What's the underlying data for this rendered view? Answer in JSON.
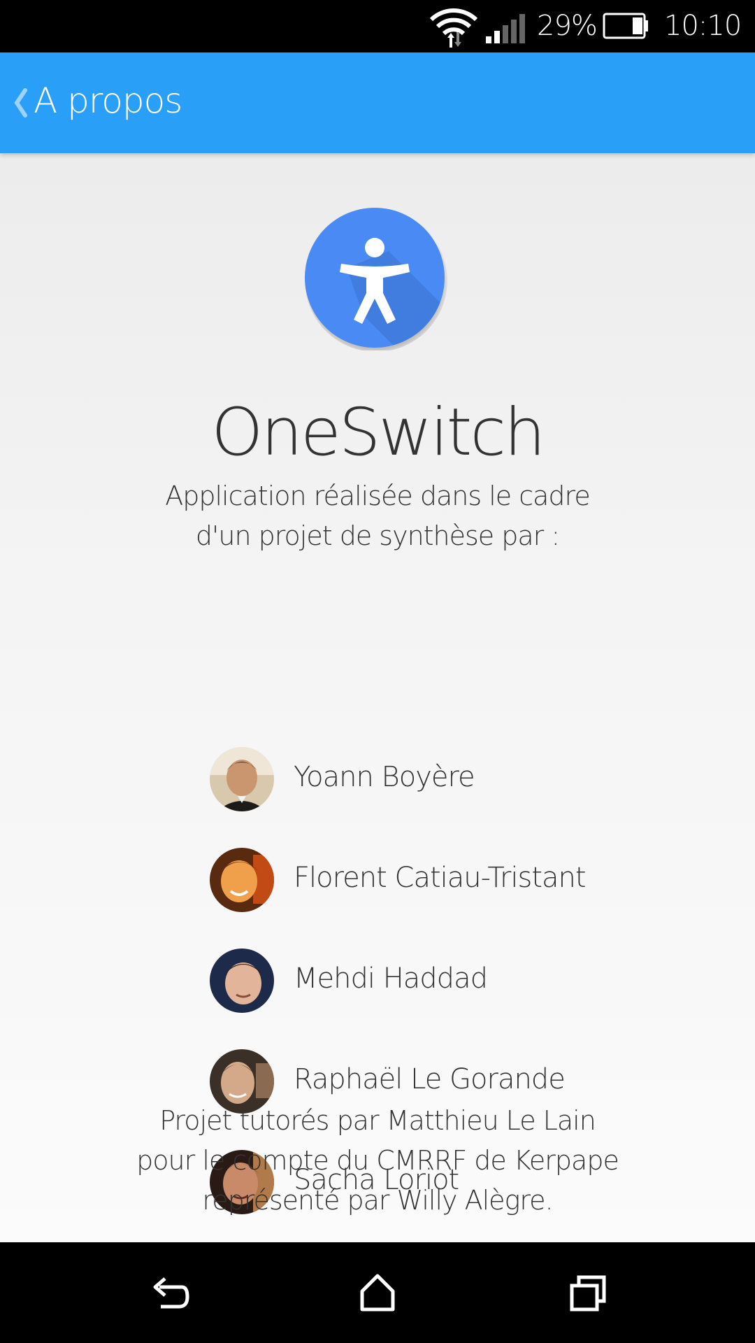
{
  "status_bar": {
    "battery_percent": "29%",
    "battery_level": 0.29,
    "time": "10:10",
    "icons": [
      "wifi-icon",
      "signal-icon",
      "battery-icon"
    ]
  },
  "action_bar": {
    "back_icon": "chevron-left-icon",
    "title": "A propos",
    "color": "#2a9ff7"
  },
  "about": {
    "logo_icon": "accessibility-person-icon",
    "logo_color": "#4a8af4",
    "app_name": "OneSwitch",
    "subtitle_line1": "Application réalisée dans le cadre",
    "subtitle_line2": "d'un projet de synthèse par :",
    "people": [
      {
        "name": "Yoann Boyère"
      },
      {
        "name": "Florent Catiau-Tristant"
      },
      {
        "name": "Mehdi Haddad"
      },
      {
        "name": "Raphaël Le Gorande"
      },
      {
        "name": "Sacha Loriot"
      }
    ],
    "footer_line1": "Projet tutorés par Matthieu Le Lain",
    "footer_line2": "pour le compte du CMRRF de Kerpape",
    "footer_line3": "représenté par Willy Alègre."
  },
  "nav_bar": {
    "icons": [
      "back-icon",
      "home-icon",
      "recents-icon"
    ]
  }
}
